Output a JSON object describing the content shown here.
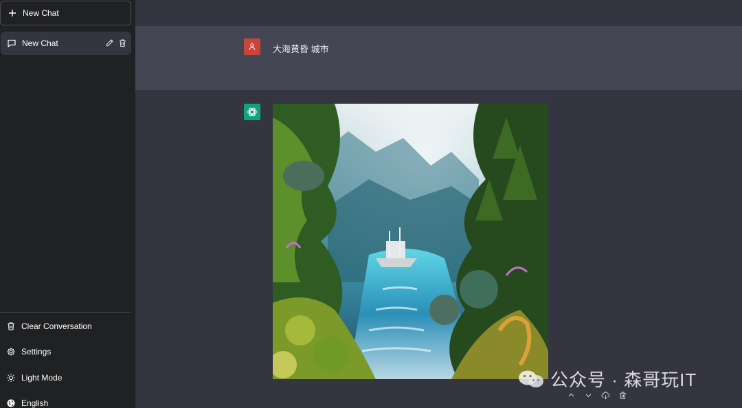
{
  "sidebar": {
    "new_chat_label": "New Chat",
    "conversations": [
      {
        "label": "New Chat"
      }
    ],
    "bottom": {
      "clear": "Clear Conversation",
      "settings": "Settings",
      "theme": "Light Mode",
      "language": "English"
    }
  },
  "chat": {
    "user_message": "大海黄昏 城市",
    "assistant_content": "generated-image"
  },
  "watermark": {
    "text": "公众号 · 森哥玩IT"
  },
  "colors": {
    "sidebar_bg": "#202123",
    "main_bg": "#343541",
    "user_row_bg": "#444654",
    "user_avatar": "#c9453a",
    "assistant_avatar": "#10a37f"
  },
  "icons": {
    "new_chat": "plus-icon",
    "conversation": "chat-bubble-icon",
    "edit": "pencil-icon",
    "delete": "trash-icon",
    "clear": "trash-icon",
    "settings": "gear-icon",
    "theme": "sun-icon",
    "language": "globe-icon",
    "user": "user-icon",
    "assistant": "openai-logo-icon",
    "up": "chevron-up-icon",
    "down": "chevron-down-icon",
    "download": "cloud-download-icon",
    "remove": "trash-icon"
  }
}
